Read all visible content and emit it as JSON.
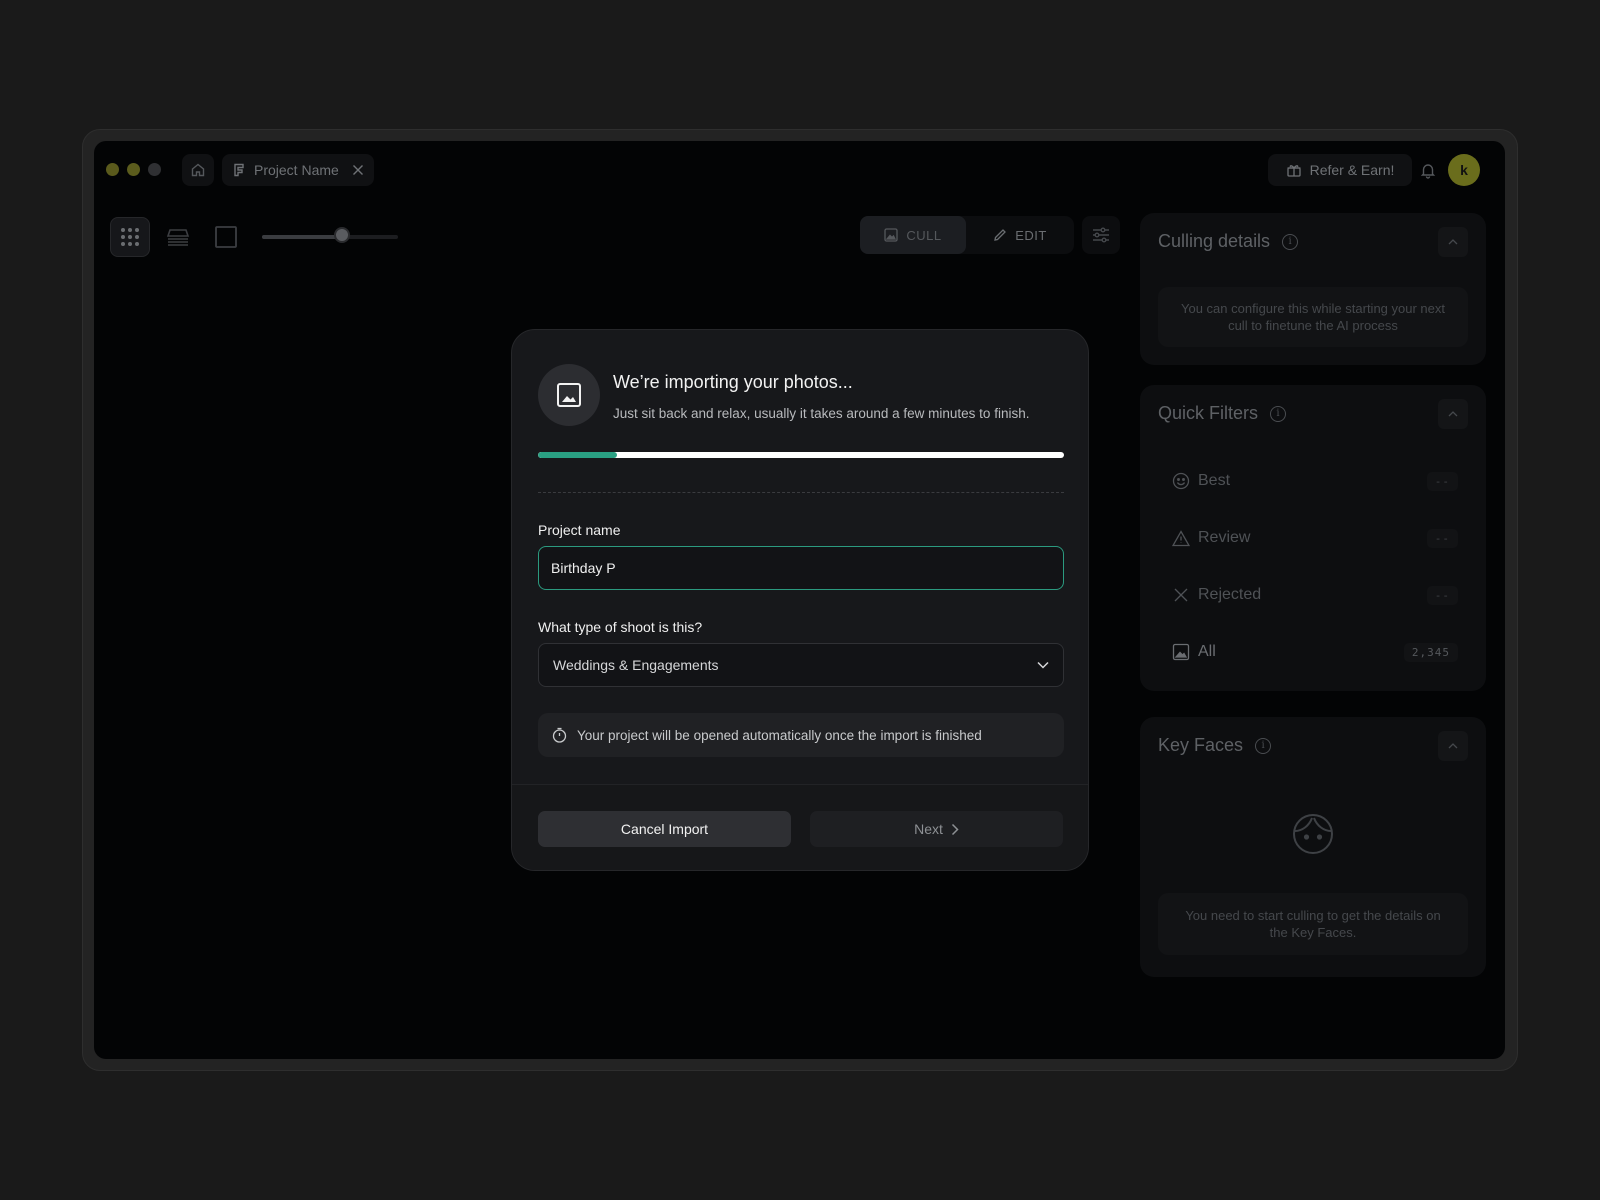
{
  "titlebar": {
    "tab_label": "Project Name",
    "refer_label": "Refer & Earn!",
    "avatar_initial": "k",
    "colors": {
      "dot_red": "#5a5a1c",
      "dot_yellow": "#5b5c1d",
      "dot_green": "#2f3033",
      "avatar": "#6a6d1c"
    }
  },
  "toolbar": {
    "cull_label": "CULL",
    "edit_label": "EDIT",
    "zoom_slider_value": 0.62,
    "active_mode": "cull"
  },
  "panels": {
    "culling": {
      "title": "Culling details",
      "hint": "You can configure this while starting your next cull to finetune the AI process"
    },
    "quick_filters": {
      "title": "Quick Filters",
      "items": [
        {
          "label": "Best",
          "count": "--",
          "icon": "smile-icon"
        },
        {
          "label": "Review",
          "count": "--",
          "icon": "warning-icon"
        },
        {
          "label": "Rejected",
          "count": "--",
          "icon": "x-icon"
        },
        {
          "label": "All",
          "count": "2,345",
          "icon": "image-icon"
        }
      ]
    },
    "key_faces": {
      "title": "Key Faces",
      "hint": "You need to start culling to get the details on the Key Faces."
    }
  },
  "modal": {
    "title": "We’re importing your photos...",
    "subtitle": "Just sit back and relax, usually it takes around a few minutes to finish.",
    "progress": 0.15,
    "project_name_label": "Project name",
    "project_name_value": "Birthday P",
    "shoot_type_label": "What type of shoot is this?",
    "shoot_type_value": "Weddings & Engagements",
    "notice": "Your project will be opened automatically once the import is finished",
    "cancel_label": "Cancel Import",
    "next_label": "Next",
    "accent_color": "#2aa083"
  }
}
